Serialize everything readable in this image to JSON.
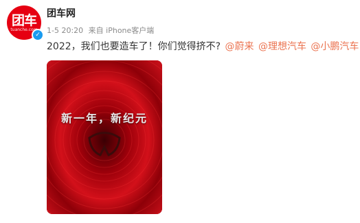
{
  "author": {
    "name": "团车网",
    "avatar_text": "团车",
    "avatar_subtext": "tuanche.com",
    "verified_icon": "check-icon"
  },
  "post": {
    "time": "1-5 20:20",
    "source": "来自 iPhone客户端",
    "text": "2022，我们也要造车了！你们觉得挤不?",
    "mentions": [
      "@蔚来",
      "@理想汽车",
      "@小鹏汽车"
    ]
  },
  "media": {
    "caption": "新一年，新纪元"
  },
  "colors": {
    "brand": "#e60012",
    "mention": "#eb7350",
    "verified": "#1a9bf0"
  }
}
